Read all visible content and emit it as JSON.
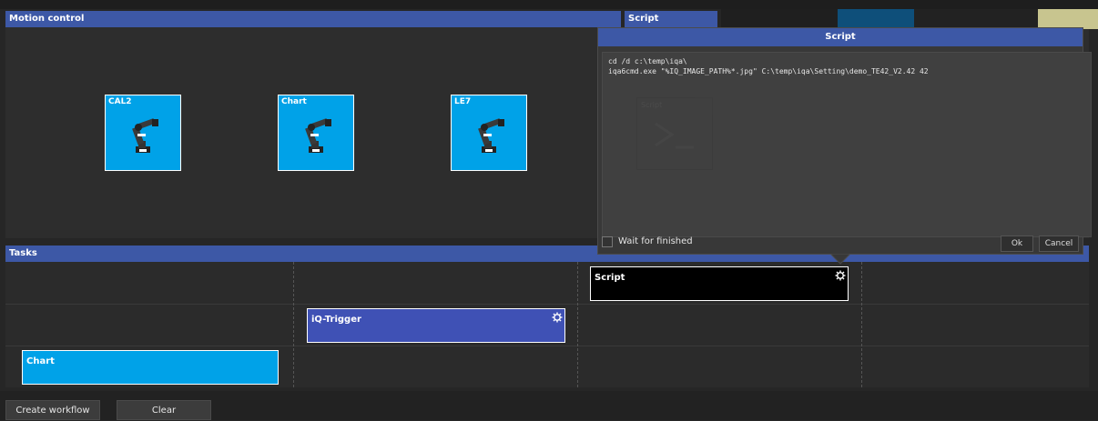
{
  "motion_panel": {
    "title": "Motion control",
    "devices": [
      {
        "label": "CAL2",
        "icon": "robot-arm-icon"
      },
      {
        "label": "Chart",
        "icon": "robot-arm-icon"
      },
      {
        "label": "LE7",
        "icon": "robot-arm-icon"
      }
    ]
  },
  "script_panel": {
    "title": "Script",
    "faded_tile_label": "Script"
  },
  "swatches": {
    "colors": [
      "#1f1f1f",
      "#0e4f7a",
      "#222222",
      "#c8c58f"
    ]
  },
  "tasks_panel": {
    "title": "Tasks",
    "blocks": {
      "script": {
        "label": "Script",
        "icon": "gear-icon"
      },
      "iq_trigger": {
        "label": "iQ-Trigger",
        "icon": "gear-icon"
      },
      "chart": {
        "label": "Chart"
      }
    }
  },
  "script_dialog": {
    "title": "Script",
    "script_text": "cd /d c:\\temp\\iqa\\\niqa6cmd.exe \"%IQ_IMAGE_PATH%*.jpg\" C:\\temp\\iqa\\Setting\\demo_TE42_V2.42 42",
    "wait_label": "Wait for finished",
    "ok_label": "Ok",
    "cancel_label": "Cancel"
  },
  "footer": {
    "create_workflow_label": "Create workflow",
    "clear_label": "Clear"
  },
  "colors": {
    "header_blue": "#3d58a6",
    "device_cyan": "#00a2e8",
    "trigger_blue": "#3f51b5",
    "background": "#262626"
  }
}
